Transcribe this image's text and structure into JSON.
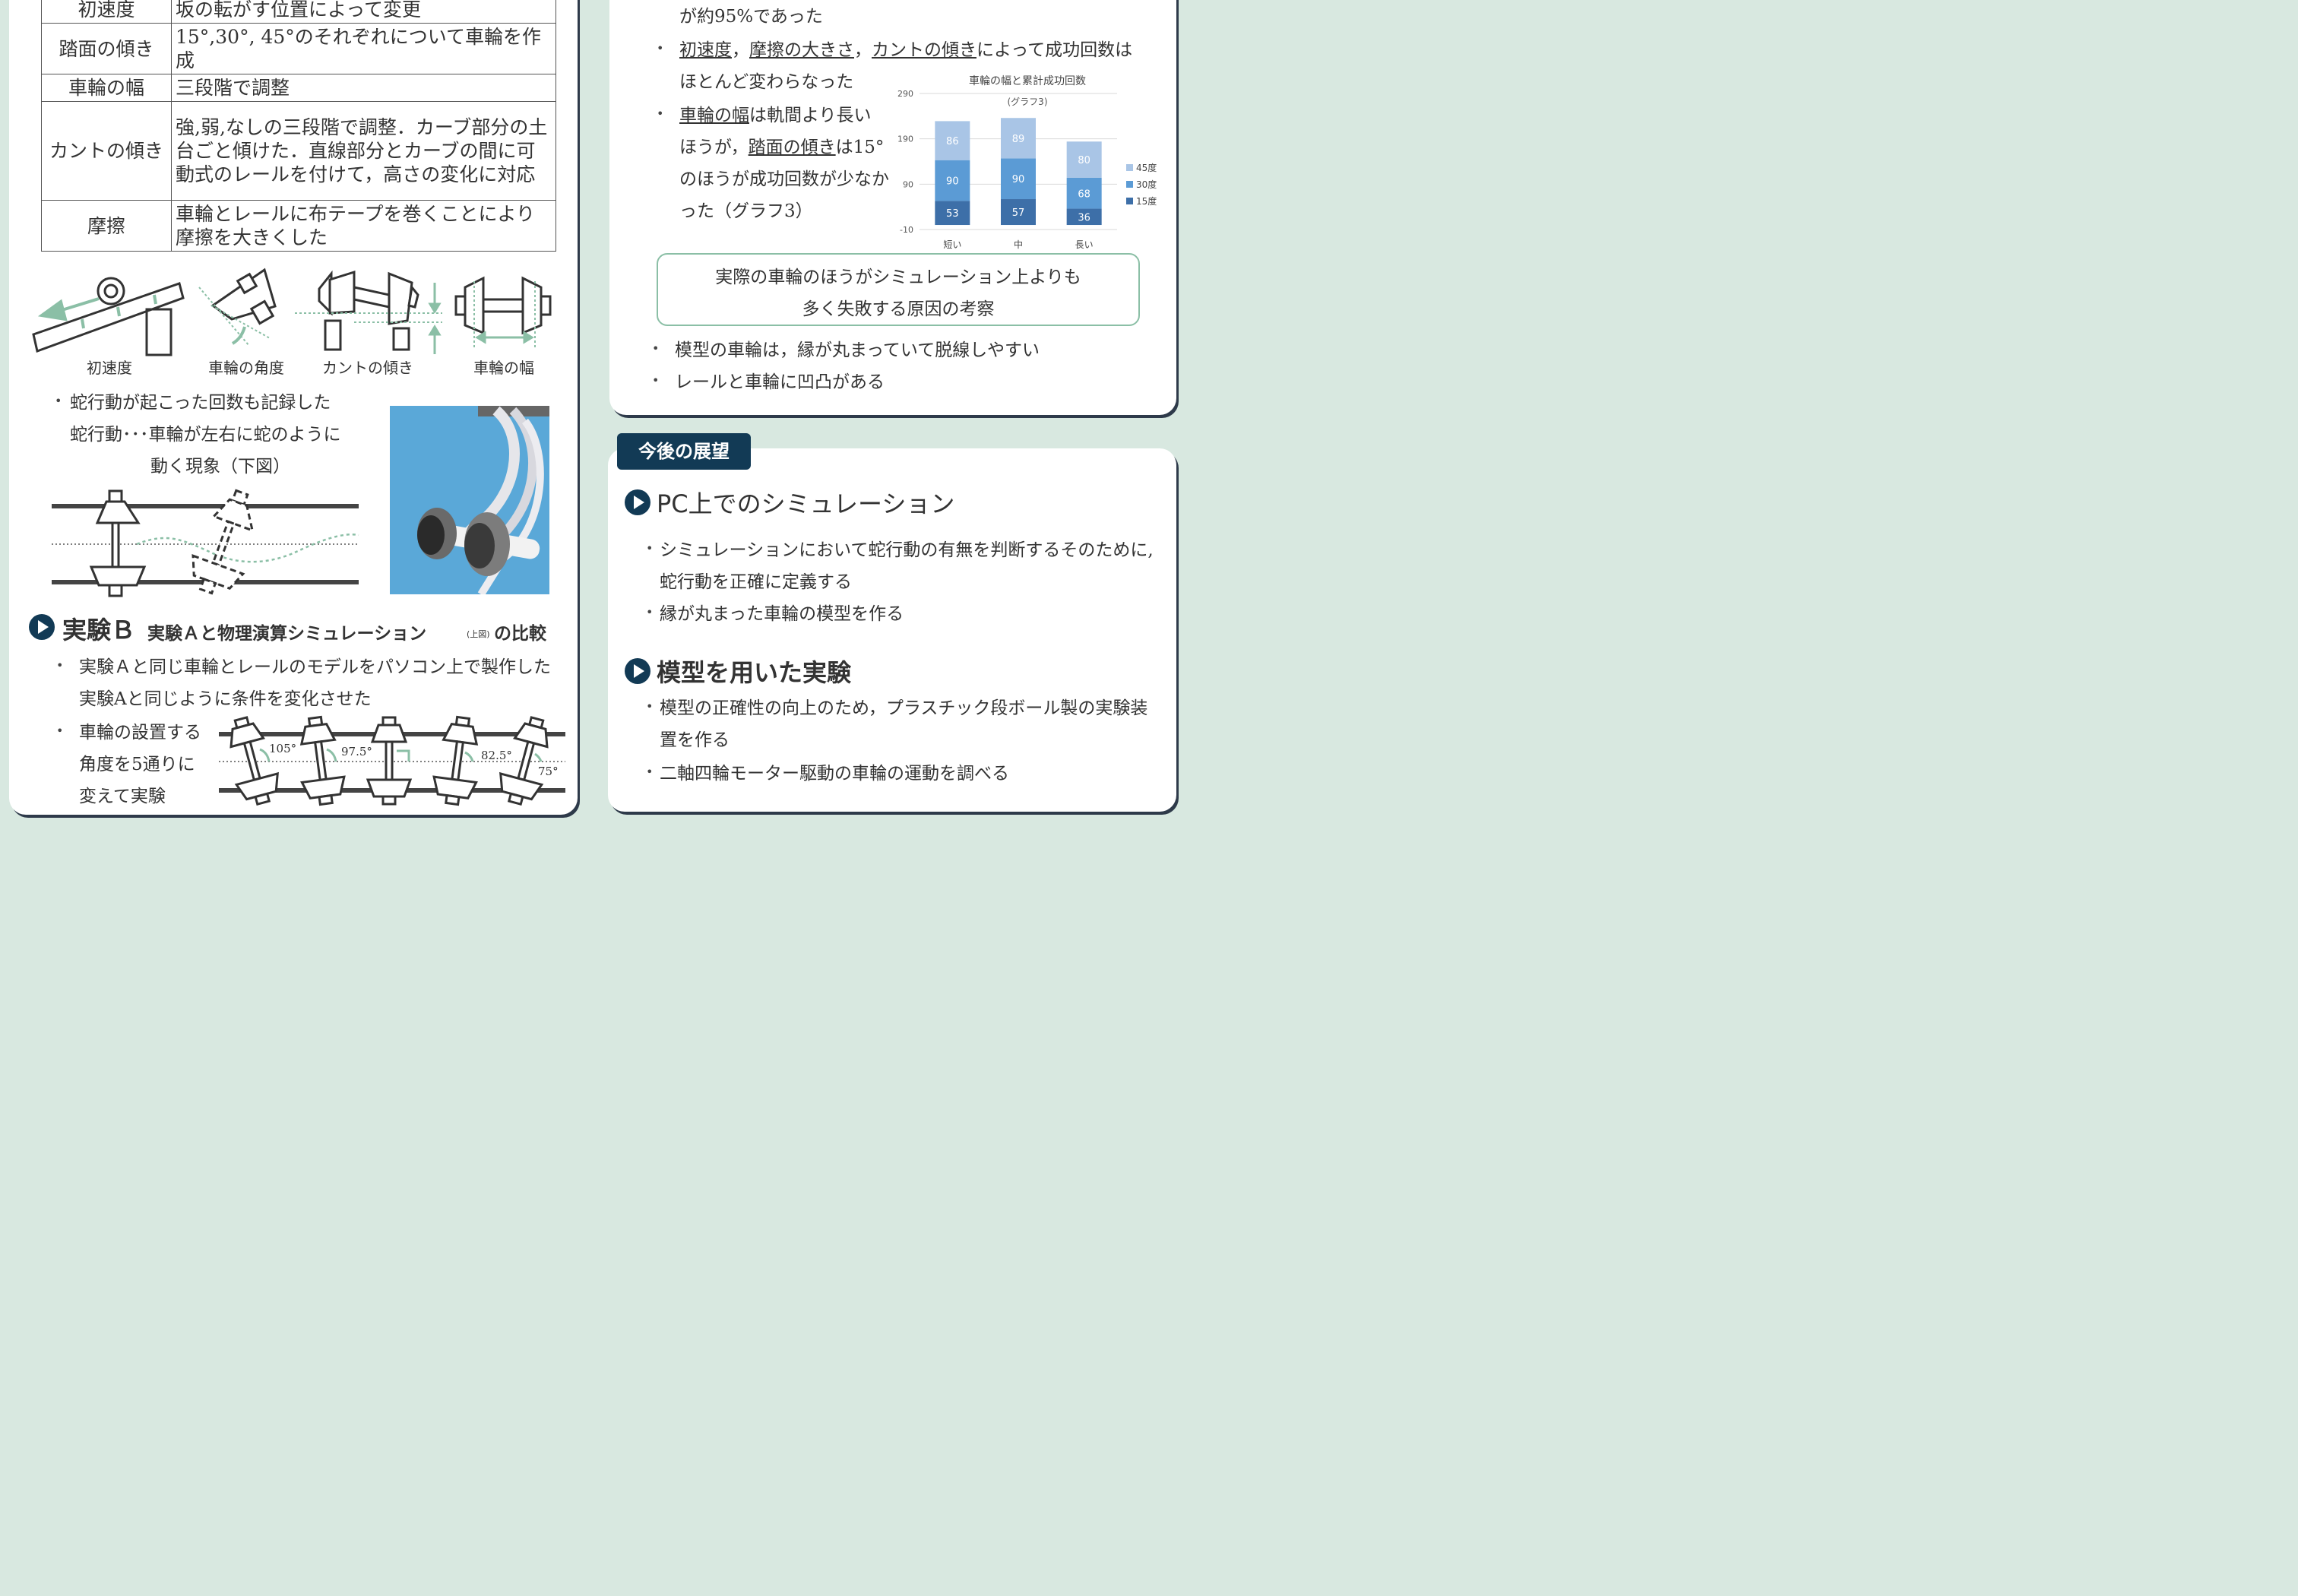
{
  "table": {
    "rows": [
      {
        "key": "初速度",
        "value": "坂の転がす位置によって変更"
      },
      {
        "key": "踏面の傾き",
        "value": "15°,30°, 45°のそれぞれについて車輪を作成"
      },
      {
        "key": "車輪の幅",
        "value": "三段階で調整"
      },
      {
        "key": "カントの傾き",
        "value": "強,弱,なしの三段階で調整．カーブ部分の土台ごと傾けた．直線部分とカーブの間に可動式のレールを付けて，高さの変化に対応"
      },
      {
        "key": "摩擦",
        "value": "車輪とレールに布テープを巻くことにより摩擦を大きくした"
      }
    ]
  },
  "diagram_labels": {
    "initial_velocity": "初速度",
    "wheel_angle": "車輪の角度",
    "cant": "カントの傾き",
    "wheel_width": "車輪の幅"
  },
  "hunting": {
    "bullet": "蛇行動が起こった回数も記録した",
    "def_line1": "蛇行動･･･車輪が左右に蛇のように",
    "def_line2": "動く現象（下図）"
  },
  "experiment_b": {
    "title_main": "実験Ｂ",
    "title_sub": "実験Ａと物理演算シミュレーション",
    "title_small": "(上図)",
    "title_end": "の比較",
    "b1_line1": "実験Ａと同じ車輪とレールのモデルをパソコン上で製作した",
    "b1_line2": "実験Aと同じように条件を変化させた",
    "b2_line1": "車輪の設置する",
    "b2_line2": "角度を5通りに",
    "b2_line3": "変えて実験",
    "angles": [
      "105°",
      "97.5°",
      "82.5°",
      "75°"
    ]
  },
  "results": {
    "line0": "が約95%であった",
    "b1_u1": "初速度",
    "b1_sep1": "，",
    "b1_u2": "摩擦の大きさ",
    "b1_sep2": "，",
    "b1_u3": "カントの傾き",
    "b1_rest": "によって成功回数は",
    "b1_line2": "ほとんど変わらなった",
    "b2_u1": "車輪の幅",
    "b2_rest1": "は軌間より長い",
    "b2_line2a": "ほうが，",
    "b2_u2": "踏面の傾き",
    "b2_line2b": "は15°",
    "b2_line3": "のほうが成功回数が少なか",
    "b2_line4": "った（グラフ3）"
  },
  "consider": {
    "box_line1": "実際の車輪のほうがシミュレーション上よりも",
    "box_line2": "多く失敗する原因の考察",
    "b1": "模型の車輪は，縁が丸まっていて脱線しやすい",
    "b2": "レールと車輪に凹凸がある"
  },
  "outlook": {
    "tag": "今後の展望",
    "h1": "PC上でのシミュレーション",
    "h1_b1_line1": "シミュレーションにおいて蛇行動の有無を判断するそのために,",
    "h1_b1_line2": "蛇行動を正確に定義する",
    "h1_b2": "縁が丸まった車輪の模型を作る",
    "h2": "模型を用いた実験",
    "h2_b1_line1": "模型の正確性の向上のため，プラスチック段ボール製の実験装",
    "h2_b1_line2": "置を作る",
    "h2_b2": "二軸四輪モーター駆動の車輪の運動を調べる"
  },
  "chart_data": {
    "type": "bar",
    "stacked": true,
    "title": "車輪の幅と累計成功回数",
    "subtitle": "(グラフ3)",
    "categories": [
      "短い",
      "中",
      "長い"
    ],
    "series": [
      {
        "name": "15度",
        "values": [
          53,
          57,
          36
        ],
        "color": "#3d6fa8"
      },
      {
        "name": "30度",
        "values": [
          90,
          90,
          68
        ],
        "color": "#5b9bd5"
      },
      {
        "name": "45度",
        "values": [
          86,
          89,
          80
        ],
        "color": "#a9c5e6"
      }
    ],
    "yticks": [
      -10,
      90,
      190,
      290
    ],
    "ylim": [
      -10,
      290
    ],
    "legend": "right",
    "grid": true
  }
}
